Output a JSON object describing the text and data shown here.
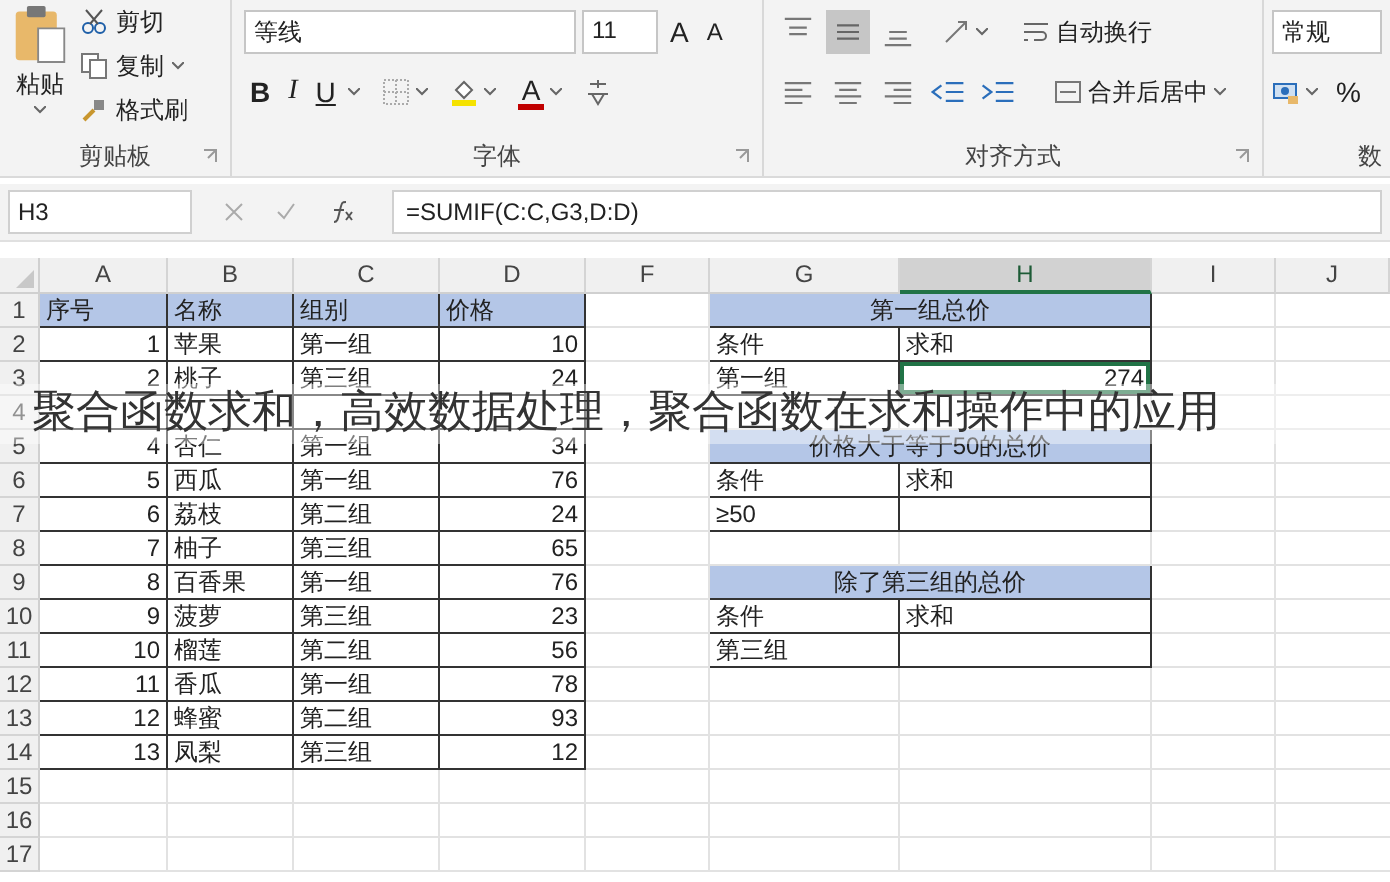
{
  "ribbon": {
    "clipboard": {
      "paste": "粘贴",
      "cut": "剪切",
      "copy": "复制",
      "format_painter": "格式刷",
      "label": "剪贴板"
    },
    "font": {
      "name": "等线",
      "size": "11",
      "grow": "A",
      "shrink": "A",
      "bold": "B",
      "italic": "I",
      "underline": "U",
      "font_color": "A",
      "label": "字体"
    },
    "alignment": {
      "vertical": [
        {
          "kind": "top",
          "selected": false
        },
        {
          "kind": "middle",
          "selected": true
        },
        {
          "kind": "bottom",
          "selected": false
        }
      ],
      "wrap": "自动换行",
      "merge": "合并后居中",
      "label": "对齐方式"
    },
    "number": {
      "format": "常规",
      "percent": "%",
      "label": "数"
    }
  },
  "formula_bar": {
    "name_box": "H3",
    "formula": "=SUMIF(C:C,G3,D:D)"
  },
  "sheet": {
    "columns": [
      {
        "label": "A",
        "selected": false
      },
      {
        "label": "B",
        "selected": false
      },
      {
        "label": "C",
        "selected": false
      },
      {
        "label": "D",
        "selected": false
      },
      {
        "label": "F",
        "selected": false
      },
      {
        "label": "G",
        "selected": false
      },
      {
        "label": "H",
        "selected": true
      },
      {
        "label": "I",
        "selected": false
      },
      {
        "label": "J",
        "selected": false
      }
    ],
    "rows": [
      {
        "number": "1",
        "cells": [
          {
            "kind": "header",
            "text": "序号"
          },
          {
            "kind": "header",
            "text": "名称"
          },
          {
            "kind": "header",
            "text": "组别"
          },
          {
            "kind": "header",
            "text": "价格"
          },
          null,
          {
            "kind": "title",
            "text": "第一组总价"
          },
          null,
          null,
          null
        ]
      },
      {
        "number": "2",
        "cells": [
          {
            "kind": "number",
            "text": "1"
          },
          {
            "kind": "text",
            "text": "苹果"
          },
          {
            "kind": "text",
            "text": "第一组"
          },
          {
            "kind": "number",
            "text": "10"
          },
          null,
          {
            "kind": "text",
            "text": "条件"
          },
          {
            "kind": "text",
            "text": "求和"
          },
          null,
          null
        ]
      },
      {
        "number": "3",
        "cells": [
          {
            "kind": "number",
            "text": "2"
          },
          {
            "kind": "text",
            "text": "桃子"
          },
          {
            "kind": "text",
            "text": "第三组"
          },
          {
            "kind": "number",
            "text": "24"
          },
          null,
          {
            "kind": "text",
            "text": "第一组"
          },
          {
            "kind": "active",
            "text": "274"
          },
          null,
          null
        ]
      },
      {
        "number": "4",
        "cells": [
          {
            "kind": "blank"
          },
          {
            "kind": "blank"
          },
          {
            "kind": "blank"
          },
          {
            "kind": "blank"
          },
          null,
          null,
          null,
          null,
          null
        ]
      },
      {
        "number": "5",
        "cells": [
          {
            "kind": "number",
            "text": "4"
          },
          {
            "kind": "text",
            "text": "杏仁"
          },
          {
            "kind": "text",
            "text": "第一组"
          },
          {
            "kind": "number",
            "text": "34"
          },
          null,
          {
            "kind": "title",
            "text": "价格大于等于50的总价"
          },
          null,
          null,
          null
        ]
      },
      {
        "number": "6",
        "cells": [
          {
            "kind": "number",
            "text": "5"
          },
          {
            "kind": "text",
            "text": "西瓜"
          },
          {
            "kind": "text",
            "text": "第一组"
          },
          {
            "kind": "number",
            "text": "76"
          },
          null,
          {
            "kind": "text",
            "text": "条件"
          },
          {
            "kind": "text",
            "text": "求和"
          },
          null,
          null
        ]
      },
      {
        "number": "7",
        "cells": [
          {
            "kind": "number",
            "text": "6"
          },
          {
            "kind": "text",
            "text": "荔枝"
          },
          {
            "kind": "text",
            "text": "第二组"
          },
          {
            "kind": "number",
            "text": "24"
          },
          null,
          {
            "kind": "text",
            "text": "≥50"
          },
          {
            "kind": "blank"
          },
          null,
          null
        ]
      },
      {
        "number": "8",
        "cells": [
          {
            "kind": "number",
            "text": "7"
          },
          {
            "kind": "text",
            "text": "柚子"
          },
          {
            "kind": "text",
            "text": "第三组"
          },
          {
            "kind": "number",
            "text": "65"
          },
          null,
          null,
          null,
          null,
          null
        ]
      },
      {
        "number": "9",
        "cells": [
          {
            "kind": "number",
            "text": "8"
          },
          {
            "kind": "text",
            "text": "百香果"
          },
          {
            "kind": "text",
            "text": "第一组"
          },
          {
            "kind": "number",
            "text": "76"
          },
          null,
          {
            "kind": "title",
            "text": "除了第三组的总价"
          },
          null,
          null,
          null
        ]
      },
      {
        "number": "10",
        "cells": [
          {
            "kind": "number",
            "text": "9"
          },
          {
            "kind": "text",
            "text": "菠萝"
          },
          {
            "kind": "text",
            "text": "第三组"
          },
          {
            "kind": "number",
            "text": "23"
          },
          null,
          {
            "kind": "text",
            "text": "条件"
          },
          {
            "kind": "text",
            "text": "求和"
          },
          null,
          null
        ]
      },
      {
        "number": "11",
        "cells": [
          {
            "kind": "number",
            "text": "10"
          },
          {
            "kind": "text",
            "text": "榴莲"
          },
          {
            "kind": "text",
            "text": "第二组"
          },
          {
            "kind": "number",
            "text": "56"
          },
          null,
          {
            "kind": "text",
            "text": "第三组"
          },
          {
            "kind": "blank"
          },
          null,
          null
        ]
      },
      {
        "number": "12",
        "cells": [
          {
            "kind": "number",
            "text": "11"
          },
          {
            "kind": "text",
            "text": "香瓜"
          },
          {
            "kind": "text",
            "text": "第一组"
          },
          {
            "kind": "number",
            "text": "78"
          },
          null,
          null,
          null,
          null,
          null
        ]
      },
      {
        "number": "13",
        "cells": [
          {
            "kind": "number",
            "text": "12"
          },
          {
            "kind": "text",
            "text": "蜂蜜"
          },
          {
            "kind": "text",
            "text": "第二组"
          },
          {
            "kind": "number",
            "text": "93"
          },
          null,
          null,
          null,
          null,
          null
        ]
      },
      {
        "number": "14",
        "cells": [
          {
            "kind": "number",
            "text": "13"
          },
          {
            "kind": "text",
            "text": "凤梨"
          },
          {
            "kind": "text",
            "text": "第三组"
          },
          {
            "kind": "number",
            "text": "12"
          },
          null,
          null,
          null,
          null,
          null
        ]
      },
      {
        "number": "15",
        "cells": [
          null,
          null,
          null,
          null,
          null,
          null,
          null,
          null,
          null
        ]
      },
      {
        "number": "16",
        "cells": [
          null,
          null,
          null,
          null,
          null,
          null,
          null,
          null,
          null
        ]
      },
      {
        "number": "17",
        "cells": [
          null,
          null,
          null,
          null,
          null,
          null,
          null,
          null,
          null
        ]
      }
    ]
  },
  "caption": "聚合函数求和，高效数据处理，聚合函数在求和操作中的应用"
}
